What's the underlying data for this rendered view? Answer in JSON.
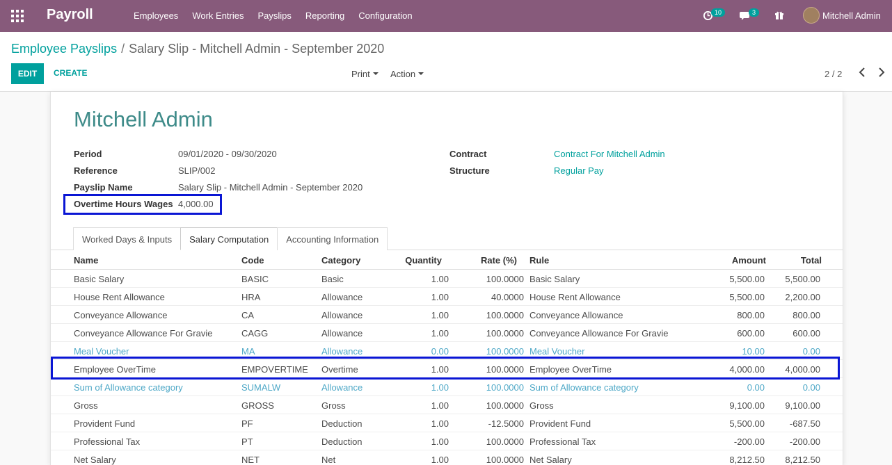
{
  "app": {
    "title": "Payroll"
  },
  "menu": [
    "Employees",
    "Work Entries",
    "Payslips",
    "Reporting",
    "Configuration"
  ],
  "systray": {
    "activity_count": "10",
    "message_count": "3",
    "user_name": "Mitchell Admin"
  },
  "breadcrumb": {
    "parent": "Employee Payslips",
    "separator": "/",
    "current": "Salary Slip - Mitchell Admin - September 2020"
  },
  "buttons": {
    "edit": "EDIT",
    "create": "CREATE",
    "print": "Print",
    "action": "Action"
  },
  "pager": {
    "value": "2 / 2"
  },
  "employee": "Mitchell Admin",
  "fields": {
    "period_label": "Period",
    "period_value": "09/01/2020 - 09/30/2020",
    "reference_label": "Reference",
    "reference_value": "SLIP/002",
    "payslip_name_label": "Payslip Name",
    "payslip_name_value": "Salary Slip - Mitchell Admin - September 2020",
    "overtime_label": "Overtime Hours Wages",
    "overtime_value": "4,000.00",
    "contract_label": "Contract",
    "contract_value": "Contract For Mitchell Admin",
    "structure_label": "Structure",
    "structure_value": "Regular Pay"
  },
  "tabs": [
    "Worked Days & Inputs",
    "Salary Computation",
    "Accounting Information"
  ],
  "table": {
    "headers": [
      "Name",
      "Code",
      "Category",
      "Quantity",
      "Rate (%)",
      "Rule",
      "Amount",
      "Total"
    ],
    "rows": [
      [
        "Basic Salary",
        "BASIC",
        "Basic",
        "1.00",
        "100.0000",
        "Basic Salary",
        "5,500.00",
        "5,500.00"
      ],
      [
        "House Rent Allowance",
        "HRA",
        "Allowance",
        "1.00",
        "40.0000",
        "House Rent Allowance",
        "5,500.00",
        "2,200.00"
      ],
      [
        "Conveyance Allowance",
        "CA",
        "Allowance",
        "1.00",
        "100.0000",
        "Conveyance Allowance",
        "800.00",
        "800.00"
      ],
      [
        "Conveyance Allowance For Gravie",
        "CAGG",
        "Allowance",
        "1.00",
        "100.0000",
        "Conveyance Allowance For Gravie",
        "600.00",
        "600.00"
      ],
      [
        "Meal Voucher",
        "MA",
        "Allowance",
        "0.00",
        "100.0000",
        "Meal Voucher",
        "10.00",
        "0.00"
      ],
      [
        "Employee OverTime",
        "EMPOVERTIME",
        "Overtime",
        "1.00",
        "100.0000",
        "Employee OverTime",
        "4,000.00",
        "4,000.00"
      ],
      [
        "Sum of Allowance category",
        "SUMALW",
        "Allowance",
        "1.00",
        "100.0000",
        "Sum of Allowance category",
        "0.00",
        "0.00"
      ],
      [
        "Gross",
        "GROSS",
        "Gross",
        "1.00",
        "100.0000",
        "Gross",
        "9,100.00",
        "9,100.00"
      ],
      [
        "Provident Fund",
        "PF",
        "Deduction",
        "1.00",
        "-12.5000",
        "Provident Fund",
        "5,500.00",
        "-687.50"
      ],
      [
        "Professional Tax",
        "PT",
        "Deduction",
        "1.00",
        "100.0000",
        "Professional Tax",
        "-200.00",
        "-200.00"
      ],
      [
        "Net Salary",
        "NET",
        "Net",
        "1.00",
        "100.0000",
        "Net Salary",
        "8,212.50",
        "8,212.50"
      ]
    ]
  },
  "colors": {
    "navbar": "#875a7b",
    "accent": "#00a09d",
    "highlight": "#0a16d4",
    "muted_row": "#4ea8c7"
  }
}
